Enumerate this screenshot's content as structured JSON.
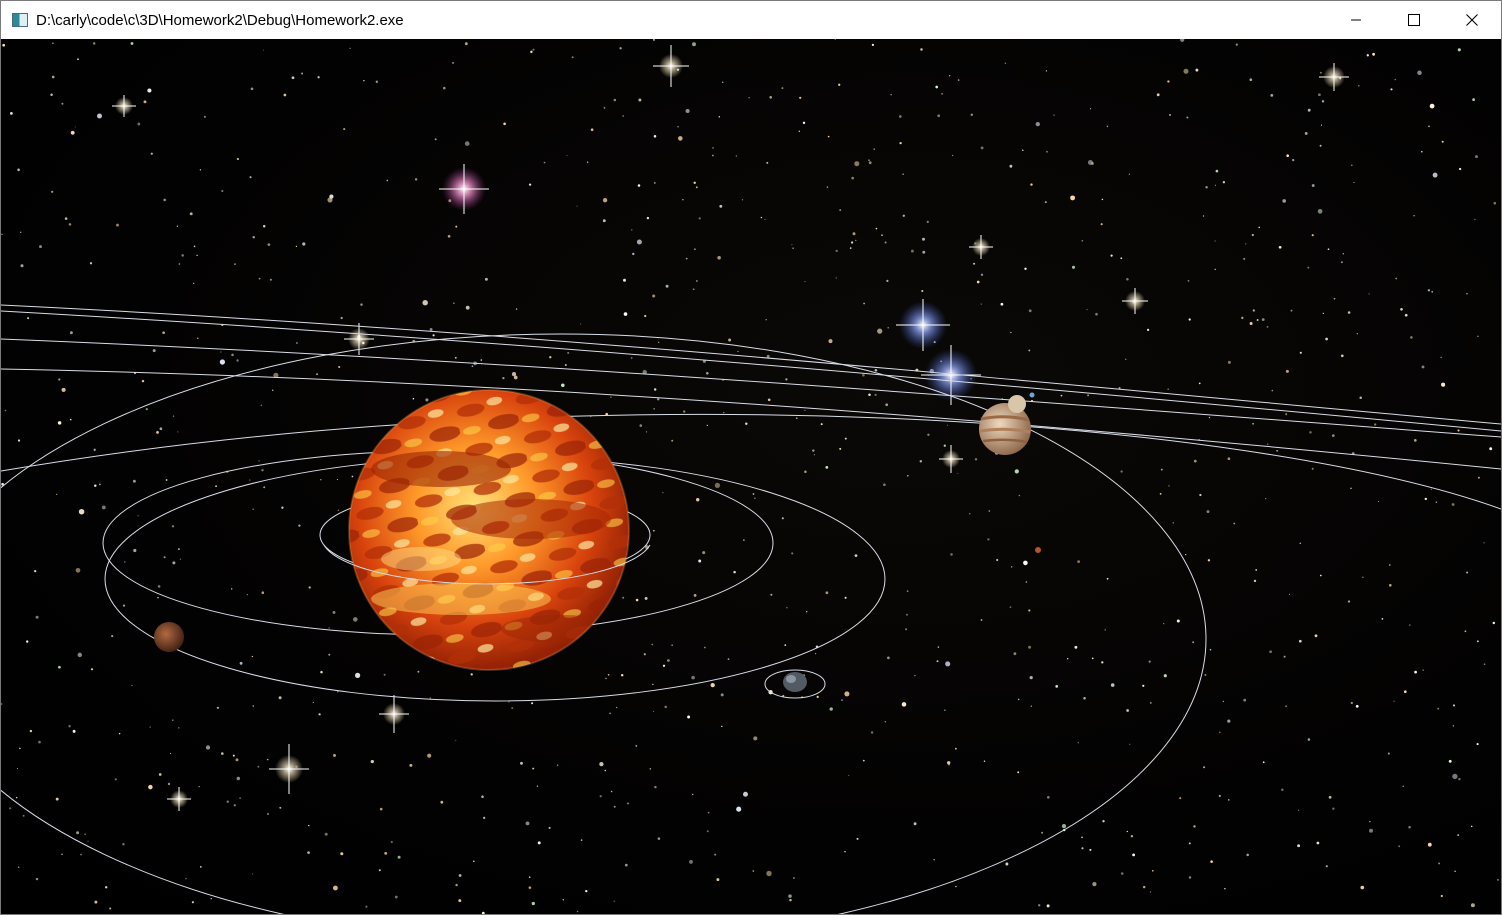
{
  "window": {
    "title": "D:\\carly\\code\\c\\3D\\Homework2\\Debug\\Homework2.exe",
    "icon": "console-app-icon",
    "controls": [
      "minimize-icon",
      "maximize-icon",
      "close-icon"
    ]
  },
  "scene": {
    "background": "starfield",
    "sun_texture_colors": [
      "#ffd34a",
      "#ff7a12",
      "#c23a08",
      "#8a1d04"
    ],
    "orbit_color": "#d9dde8",
    "planets": [
      {
        "name": "mars-like",
        "color": "#8a4a2e"
      },
      {
        "name": "earth-like",
        "color": "#5b6470"
      },
      {
        "name": "jupiter-like",
        "color": "#c9a37e"
      },
      {
        "name": "small-moon",
        "color": "#d9c6a8"
      },
      {
        "name": "tiny-red-planet",
        "color": "#b0552a"
      }
    ]
  }
}
